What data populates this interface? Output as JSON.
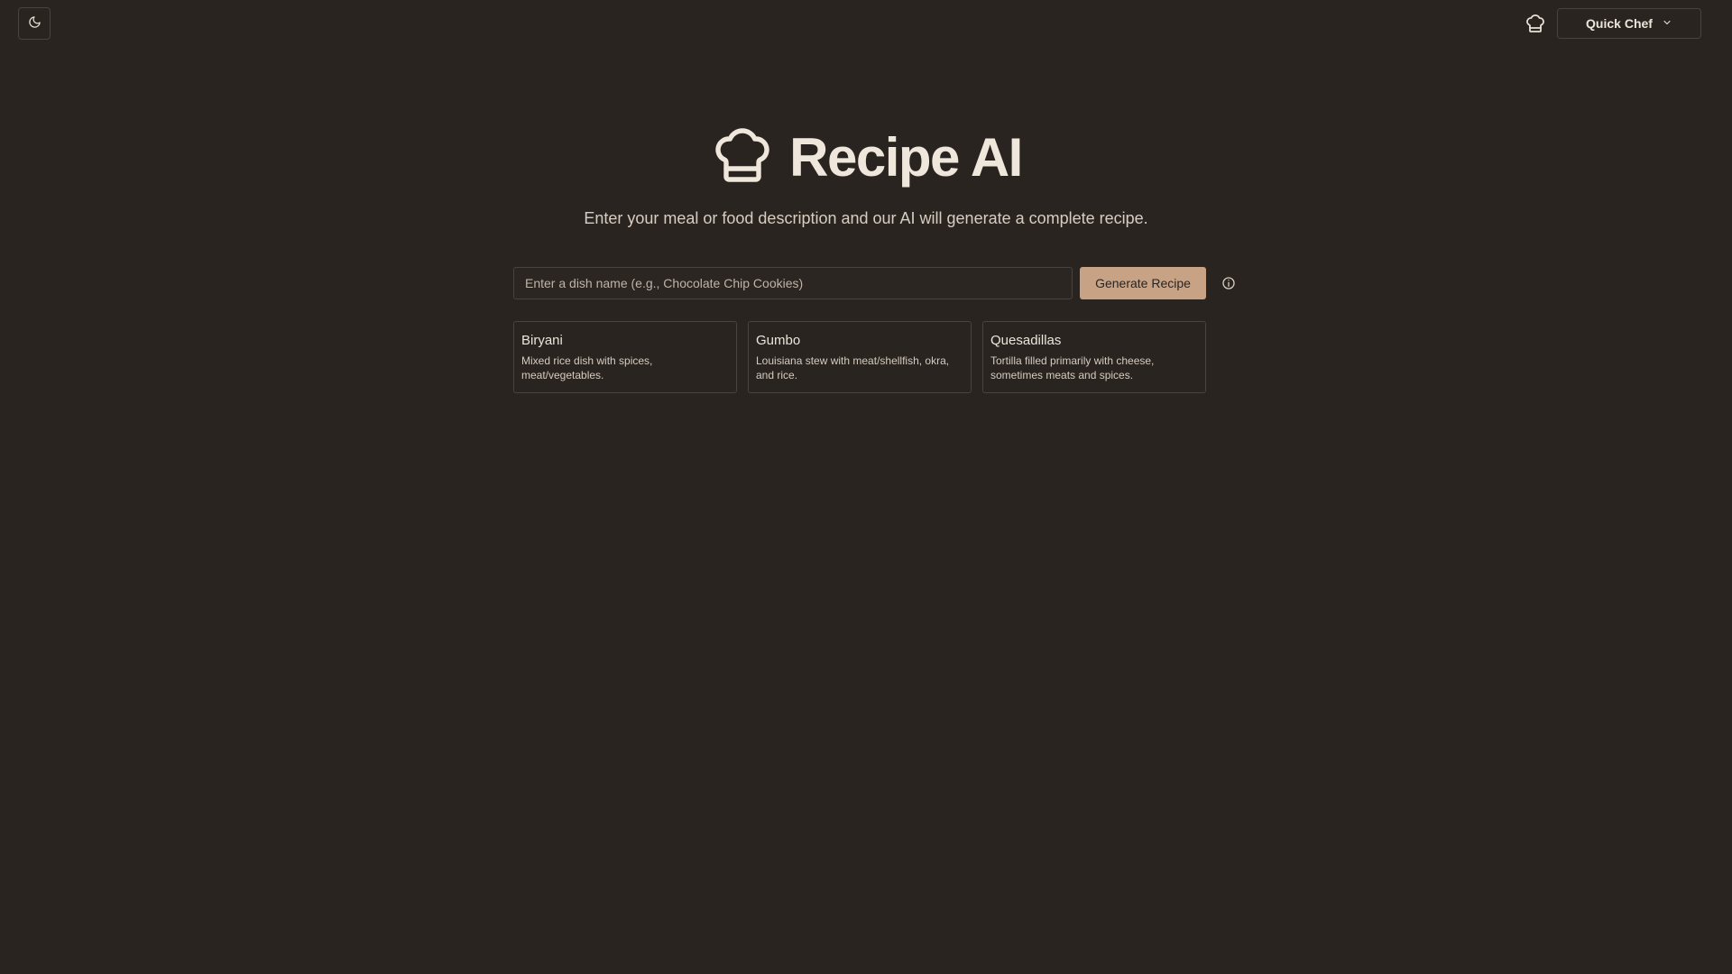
{
  "app": {
    "title": "Recipe AI",
    "subtitle": "Enter your meal or food description and our AI will generate a complete recipe."
  },
  "header": {
    "theme_toggle_icon": "moon-icon",
    "chef_icon": "chef-hat-icon",
    "mode_selector": {
      "selected": "Quick Chef",
      "icon": "chevron-down-icon"
    }
  },
  "search": {
    "placeholder": "Enter a dish name (e.g., Chocolate Chip Cookies)",
    "value": "",
    "generate_label": "Generate Recipe",
    "info_icon": "info-icon"
  },
  "suggestions": [
    {
      "title": "Biryani",
      "description": "Mixed rice dish with spices, meat/vegetables."
    },
    {
      "title": "Gumbo",
      "description": "Louisiana stew with meat/shellfish, okra, and rice."
    },
    {
      "title": "Quesadillas",
      "description": "Tortilla filled primarily with cheese, sometimes meats and spices."
    }
  ],
  "colors": {
    "background": "#2a2421",
    "accent": "#c7a284",
    "border": "#4a423d",
    "text": "#e9e2d8"
  }
}
